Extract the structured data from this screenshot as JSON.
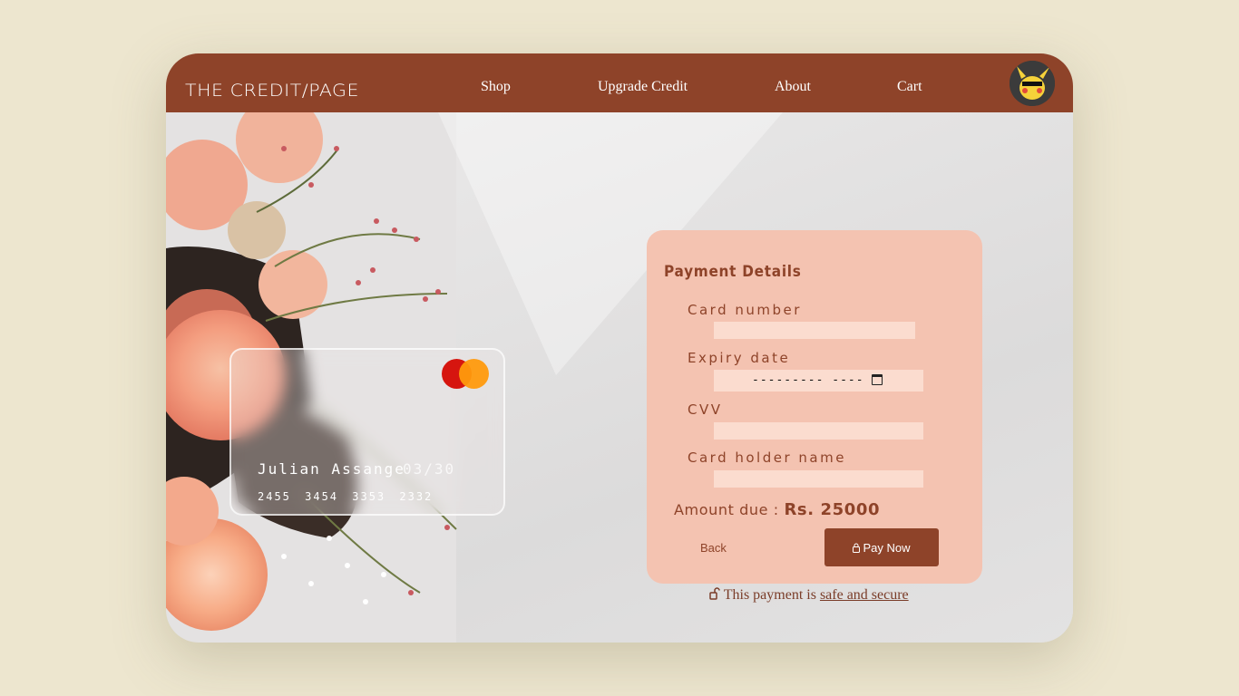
{
  "header": {
    "logo": "THE CREDIT/PAGE",
    "nav": [
      "Shop",
      "Upgrade Credit",
      "About",
      "Cart"
    ]
  },
  "card_preview": {
    "holder": "Julian Assange",
    "expiry": "03/30",
    "number": "2455 3454 3353 2332"
  },
  "payment": {
    "title": "Payment Details",
    "labels": {
      "card_number": "Card number",
      "expiry": "Expiry date",
      "cvv": "CVV",
      "holder": "Card holder name"
    },
    "date_placeholder": "--------- ----",
    "amount_label": "Amount due : ",
    "amount_value": "Rs. 25000",
    "back": "Back",
    "pay": "Pay Now"
  },
  "footer": {
    "text": "This payment is ",
    "link": "safe and secure"
  },
  "colors": {
    "page_bg": "#ede6cf",
    "accent": "#8e4329",
    "panel": "#f4c3b1",
    "input": "#fbdccf"
  },
  "icons": [
    "lock-icon",
    "mastercard-logo",
    "calendar-icon",
    "avatar-pikachu"
  ]
}
